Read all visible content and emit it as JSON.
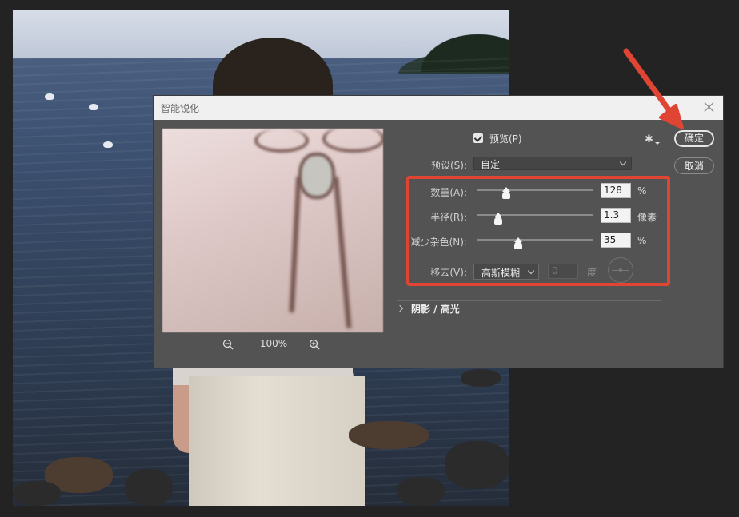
{
  "dialog": {
    "title": "智能锐化",
    "preview_label": "预览(P)",
    "preview_checked": true,
    "preset_label": "预设(S):",
    "preset_value": "自定",
    "ok_label": "确定",
    "cancel_label": "取消",
    "zoom_level": "100%",
    "amount": {
      "label": "数量(A):",
      "value": "128",
      "unit": "%",
      "slider_fraction": 0.25
    },
    "radius": {
      "label": "半径(R):",
      "value": "1.3",
      "unit": "像素",
      "slider_fraction": 0.18
    },
    "noise": {
      "label": "减少杂色(N):",
      "value": "35",
      "unit": "%",
      "slider_fraction": 0.35
    },
    "remove": {
      "label": "移去(V):",
      "value": "高斯模糊",
      "angle_value": "0",
      "angle_unit": "度"
    },
    "shadow_highlight_label": "阴影 / 高光"
  },
  "colors": {
    "annotation": "#e04433",
    "dialog_bg": "#535353"
  },
  "icons": [
    "close-icon",
    "zoom-out-icon",
    "zoom-in-icon",
    "gear-icon",
    "checkbox-icon",
    "chevron-down-icon",
    "chevron-right-icon",
    "angle-dial-icon",
    "arrow-annotation"
  ]
}
